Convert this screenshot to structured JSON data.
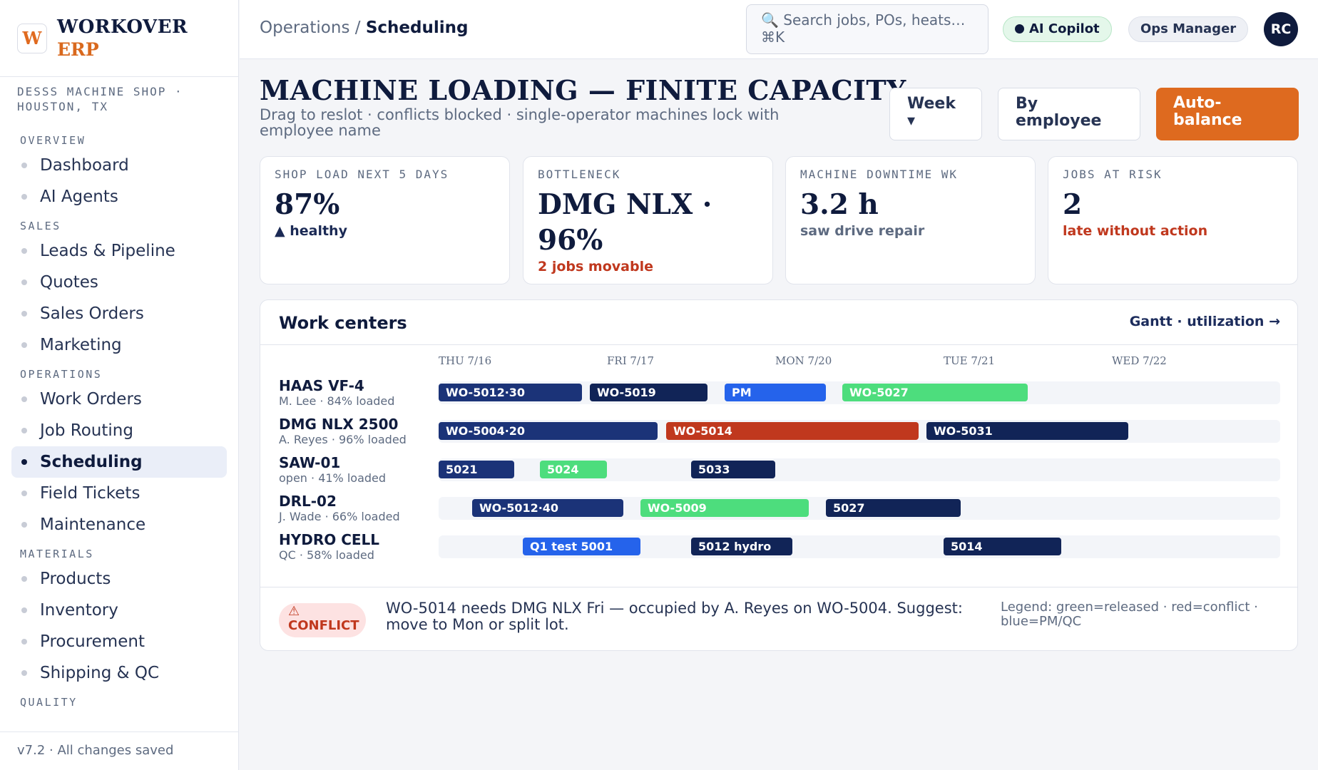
{
  "brand": {
    "logo_letter": "W",
    "name": "WORKOVER",
    "sub": "ERP",
    "shop": "DESSS MACHINE SHOP · HOUSTON, TX"
  },
  "nav": {
    "overview": {
      "title": "OVERVIEW",
      "items": [
        "Dashboard",
        "AI Agents"
      ]
    },
    "sales": {
      "title": "SALES",
      "items": [
        "Leads & Pipeline",
        "Quotes",
        "Sales Orders",
        "Marketing"
      ]
    },
    "operations": {
      "title": "OPERATIONS",
      "items": [
        "Work Orders",
        "Job Routing",
        "Scheduling",
        "Field Tickets",
        "Maintenance"
      ]
    },
    "materials": {
      "title": "MATERIALS",
      "items": [
        "Products",
        "Inventory",
        "Procurement",
        "Shipping & QC"
      ]
    },
    "quality": {
      "title": "QUALITY"
    },
    "active": "Scheduling",
    "footer": "v7.2 · All changes saved"
  },
  "topbar": {
    "crumb_parent": "Operations / ",
    "crumb_current": "Scheduling",
    "search_placeholder": "🔍 Search jobs, POs, heats… ⌘K",
    "ai_label": "AI Copilot",
    "role_label": "Ops Manager",
    "avatar_initials": "RC"
  },
  "page": {
    "title": "MACHINE LOADING — FINITE CAPACITY",
    "subtitle": "Drag to reslot · conflicts blocked · single-operator machines lock with employee name",
    "btn_week": "Week ▾",
    "btn_employee": "By employee",
    "btn_auto": "Auto-balance"
  },
  "kpis": [
    {
      "label": "SHOP LOAD NEXT 5 DAYS",
      "value": "87%",
      "note": "▲ healthy",
      "note_color": "#1b2a55"
    },
    {
      "label": "BOTTLENECK",
      "value": "DMG NLX · 96%",
      "note": "2 jobs movable",
      "note_color": "#c0381e"
    },
    {
      "label": "MACHINE DOWNTIME WK",
      "value": "3.2 h",
      "note": "saw drive repair",
      "note_color": "#5d6a80"
    },
    {
      "label": "JOBS AT RISK",
      "value": "2",
      "note": "late without action",
      "note_color": "#c0381e"
    }
  ],
  "panel": {
    "title": "Work centers",
    "link": "Gantt · utilization →",
    "days": [
      "THU 7/16",
      "FRI 7/17",
      "MON 7/20",
      "TUE 7/21",
      "WED 7/22"
    ],
    "work_centers": [
      {
        "name": "HAAS VF-4",
        "sub": "M. Lee · 84% loaded",
        "jobs": [
          {
            "label": "WO-5012·30",
            "start": 0.0,
            "end": 0.85,
            "color": "#1b3378"
          },
          {
            "label": "WO-5019",
            "start": 0.9,
            "end": 1.6,
            "color": "#112457"
          },
          {
            "label": "PM",
            "start": 1.7,
            "end": 2.3,
            "color": "#2563eb"
          },
          {
            "label": "WO-5027",
            "start": 2.4,
            "end": 3.5,
            "color": "#4ddd7d"
          }
        ]
      },
      {
        "name": "DMG NLX 2500",
        "sub": "A. Reyes · 96% loaded",
        "jobs": [
          {
            "label": "WO-5004·20",
            "start": 0.0,
            "end": 1.3,
            "color": "#1b3378"
          },
          {
            "label": "WO-5014",
            "start": 1.35,
            "end": 2.85,
            "color": "#c0381e"
          },
          {
            "label": "WO-5031",
            "start": 2.9,
            "end": 4.1,
            "color": "#112457"
          }
        ]
      },
      {
        "name": "SAW-01",
        "sub": "open · 41% loaded",
        "jobs": [
          {
            "label": "5021",
            "start": 0.0,
            "end": 0.45,
            "color": "#1b3378"
          },
          {
            "label": "5024",
            "start": 0.6,
            "end": 1.0,
            "color": "#4ddd7d"
          },
          {
            "label": "5033",
            "start": 1.5,
            "end": 2.0,
            "color": "#112457"
          }
        ]
      },
      {
        "name": "DRL-02",
        "sub": "J. Wade · 66% loaded",
        "jobs": [
          {
            "label": "WO-5012·40",
            "start": 0.2,
            "end": 1.1,
            "color": "#1b3378"
          },
          {
            "label": "WO-5009",
            "start": 1.2,
            "end": 2.2,
            "color": "#4ddd7d"
          },
          {
            "label": "5027",
            "start": 2.3,
            "end": 3.1,
            "color": "#112457"
          }
        ]
      },
      {
        "name": "HYDRO CELL",
        "sub": "QC · 58% loaded",
        "jobs": [
          {
            "label": "Q1 test 5001",
            "start": 0.5,
            "end": 1.2,
            "color": "#2563eb"
          },
          {
            "label": "5012 hydro",
            "start": 1.5,
            "end": 2.1,
            "color": "#112457"
          },
          {
            "label": "5014",
            "start": 3.0,
            "end": 3.7,
            "color": "#112457"
          }
        ]
      }
    ],
    "conflict_badge": "⚠ CONFLICT",
    "conflict_text": "WO-5014 needs DMG NLX Fri — occupied by A. Reyes on WO-5004. Suggest: move to Mon or split lot.",
    "legend": "Legend: green=released · red=conflict · blue=PM/QC"
  }
}
